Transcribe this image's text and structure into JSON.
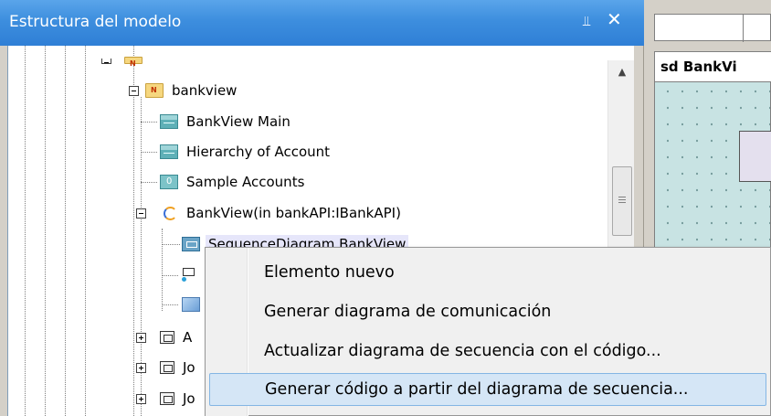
{
  "panel": {
    "title": "Estructura del modelo",
    "pin_icon": "pin-icon",
    "close_icon": "close-icon"
  },
  "tree": {
    "items": [
      {
        "label": "bankview",
        "icon": "package-folder-icon",
        "expanded": true
      },
      {
        "label": "BankView Main",
        "icon": "class-diagram-icon"
      },
      {
        "label": "Hierarchy of Account",
        "icon": "class-diagram-icon"
      },
      {
        "label": "Sample Accounts",
        "icon": "object-diagram-icon"
      },
      {
        "label": "BankView(in bankAPI:IBankAPI)",
        "icon": "interface-realization-icon",
        "expanded": true
      },
      {
        "label": "SequenceDiagram BankView",
        "icon": "sequence-diagram-icon",
        "selected": true
      },
      {
        "label": "",
        "icon": "communication-diagram-icon"
      },
      {
        "label": "",
        "icon": "diagram-icon"
      },
      {
        "label": "A",
        "icon": "package-icon",
        "expanded": false
      },
      {
        "label": "Jo",
        "icon": "package-icon",
        "expanded": false
      },
      {
        "label": "Jo",
        "icon": "package-icon",
        "expanded": false
      }
    ]
  },
  "diagram": {
    "title": "sd BankVi"
  },
  "context_menu": {
    "items": [
      {
        "label": "Elemento nuevo"
      },
      {
        "label": "Generar diagrama de comunicación"
      },
      {
        "label": "Actualizar diagrama de secuencia con el código..."
      },
      {
        "label": "Generar código a partir del diagrama de secuencia...",
        "highlighted": true
      }
    ]
  },
  "colors": {
    "titlebar": "#3d8ede",
    "menu_highlight": "#d5e6f6",
    "diagram_canvas": "#c8e3e3"
  }
}
